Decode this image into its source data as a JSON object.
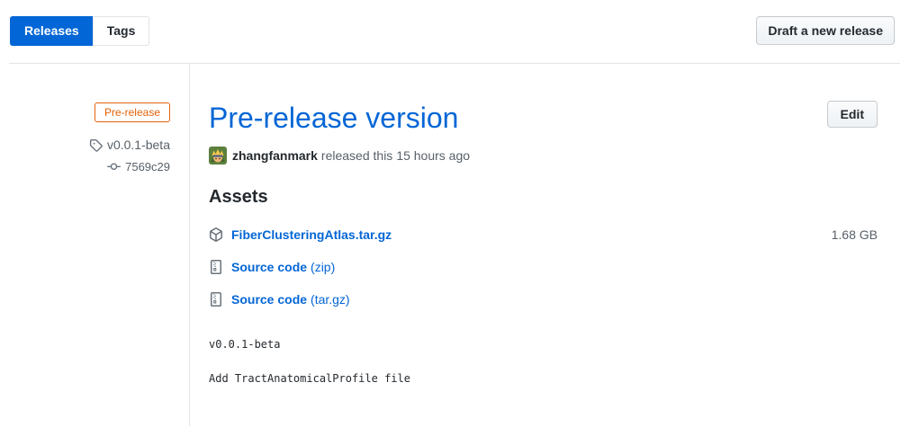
{
  "colors": {
    "accent_blue": "#0366d6",
    "prerelease_orange": "#e36209",
    "border_gray": "#e1e4e8",
    "muted_gray": "#586069"
  },
  "header": {
    "tabs": [
      {
        "label": "Releases",
        "active": true
      },
      {
        "label": "Tags",
        "active": false
      }
    ],
    "draft_button_label": "Draft a new release"
  },
  "sidebar": {
    "prerelease_badge": "Pre-release",
    "tag_name": "v0.0.1-beta",
    "commit_sha": "7569c29"
  },
  "release": {
    "title": "Pre-release version",
    "edit_button_label": "Edit",
    "author": "zhangfanmark",
    "released_text": "released this",
    "released_time": "15 hours ago",
    "assets_heading": "Assets",
    "assets": [
      {
        "name": "FiberClusteringAtlas.tar.gz",
        "suffix": "",
        "size": "1.68 GB",
        "icon": "package-icon"
      },
      {
        "name": "Source code",
        "suffix": "(zip)",
        "size": "",
        "icon": "file-zip-icon"
      },
      {
        "name": "Source code",
        "suffix": "(tar.gz)",
        "size": "",
        "icon": "file-zip-icon"
      }
    ],
    "body_lines": [
      "v0.0.1-beta",
      "Add TractAnatomicalProfile file"
    ]
  }
}
